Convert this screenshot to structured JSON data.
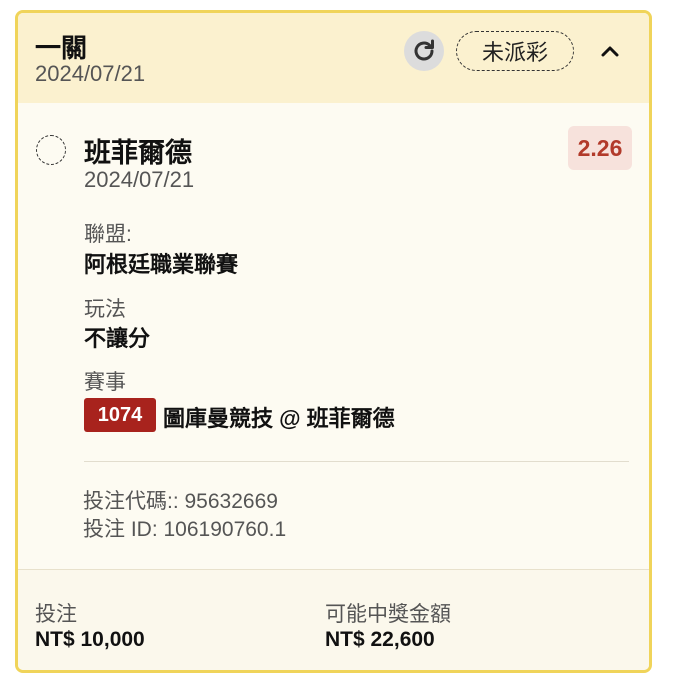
{
  "header": {
    "bet_type": "一關",
    "date": "2024/07/21",
    "status": "未派彩"
  },
  "selection": {
    "team": "班菲爾德",
    "date": "2024/07/21",
    "odds": "2.26",
    "league_label": "聯盟:",
    "league_value": "阿根廷職業聯賽",
    "market_label": "玩法",
    "market_value": "不讓分",
    "event_label": "賽事",
    "event_id": "1074",
    "event_name": "圖庫曼競技 @ 班菲爾德"
  },
  "meta": {
    "bet_code": "投注代碼:: 95632669",
    "bet_id": "投注 ID: 106190760.1"
  },
  "footer": {
    "stake_label": "投注",
    "stake_value": "NT$ 10,000",
    "payout_label": "可能中獎金額",
    "payout_value": "NT$ 22,600"
  },
  "colors": {
    "card_border": "#f0d45a",
    "header_bg": "#fbf1cf",
    "odds_text": "#b23a2a",
    "event_badge": "#a8231d"
  },
  "icons": {
    "refresh": "refresh-icon",
    "collapse": "chevron-up-icon",
    "select": "radio-circle-icon"
  }
}
